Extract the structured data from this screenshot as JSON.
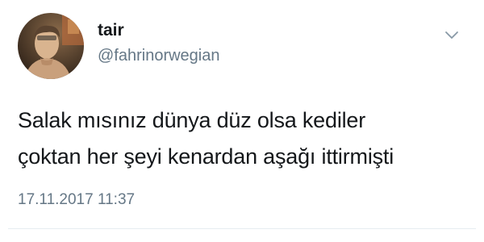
{
  "tweet": {
    "author": {
      "display_name": "tair",
      "handle": "@fahrinorwegian",
      "avatar_icon": "profile-photo"
    },
    "text_lines": [
      "Salak mısınız dünya düz olsa kediler",
      "çoktan her şeyi kenardan aşağı ittirmişti"
    ],
    "timestamp": "17.11.2017 11:37",
    "menu_icon": "chevron-down-icon"
  },
  "colors": {
    "text_primary": "#14171a",
    "text_secondary": "#657786",
    "divider": "#e6ecf0",
    "background": "#ffffff"
  }
}
